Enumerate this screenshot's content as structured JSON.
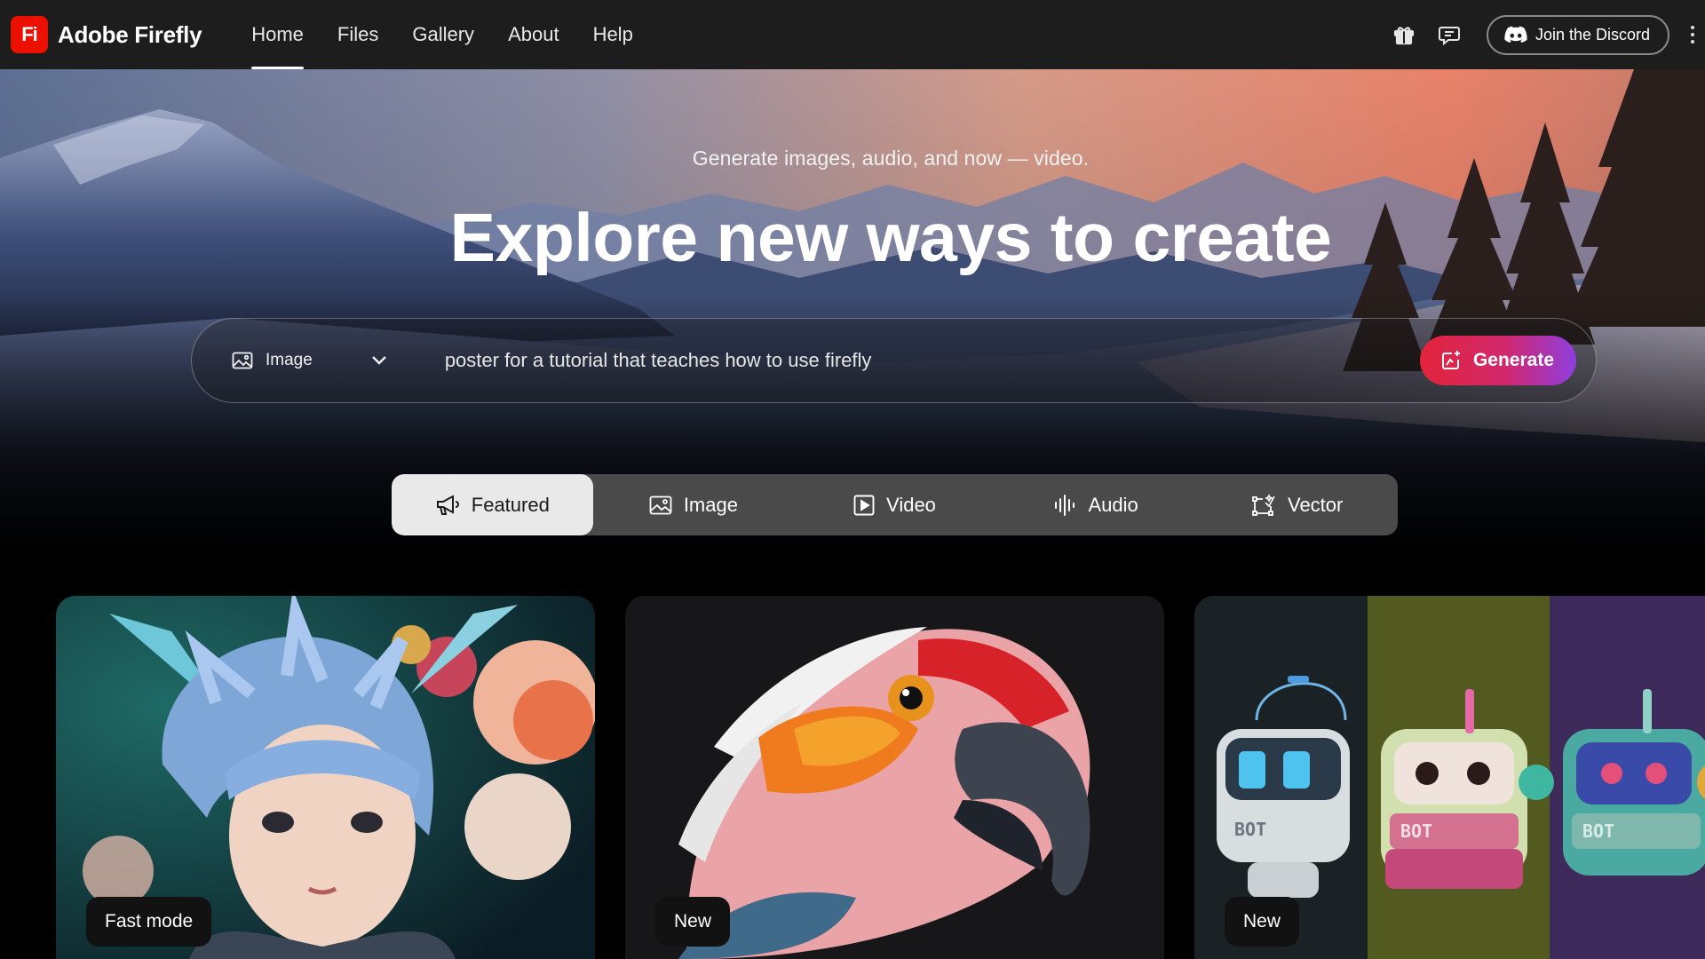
{
  "app": {
    "brand_logo_text": "Fi",
    "brand_name": "Adobe Firefly"
  },
  "nav": {
    "links": [
      {
        "label": "Home",
        "active": true
      },
      {
        "label": "Files"
      },
      {
        "label": "Gallery"
      },
      {
        "label": "About"
      },
      {
        "label": "Help"
      }
    ],
    "icons": [
      "gift-icon",
      "chat-feedback-icon"
    ],
    "discord_label": "Join the Discord"
  },
  "hero": {
    "subtitle": "Generate images, audio, and now — video.",
    "title": "Explore new ways to create",
    "prompt": {
      "mode": "Image",
      "value": "poster for a tutorial that teaches how to use firefly",
      "generate_label": "Generate"
    }
  },
  "tabs": [
    {
      "label": "Featured",
      "icon": "megaphone-icon",
      "active": true
    },
    {
      "label": "Image",
      "icon": "image-icon"
    },
    {
      "label": "Video",
      "icon": "video-icon"
    },
    {
      "label": "Audio",
      "icon": "audio-waveform-icon"
    },
    {
      "label": "Vector",
      "icon": "vector-icon"
    }
  ],
  "cards": [
    {
      "badge": "Fast mode",
      "subject": "blue-haired child with flowers"
    },
    {
      "badge": "New",
      "subject": "parrot"
    },
    {
      "badge": "New",
      "subject": "BOT robots"
    }
  ],
  "colors": {
    "nav_bg": "#1d1d1d",
    "logo_red": "#eb1000",
    "generate_gradient": [
      "#e3243b",
      "#8e3ee0"
    ],
    "tab_bar": "#4a4a4a",
    "tab_active": "#e9e9e9"
  }
}
